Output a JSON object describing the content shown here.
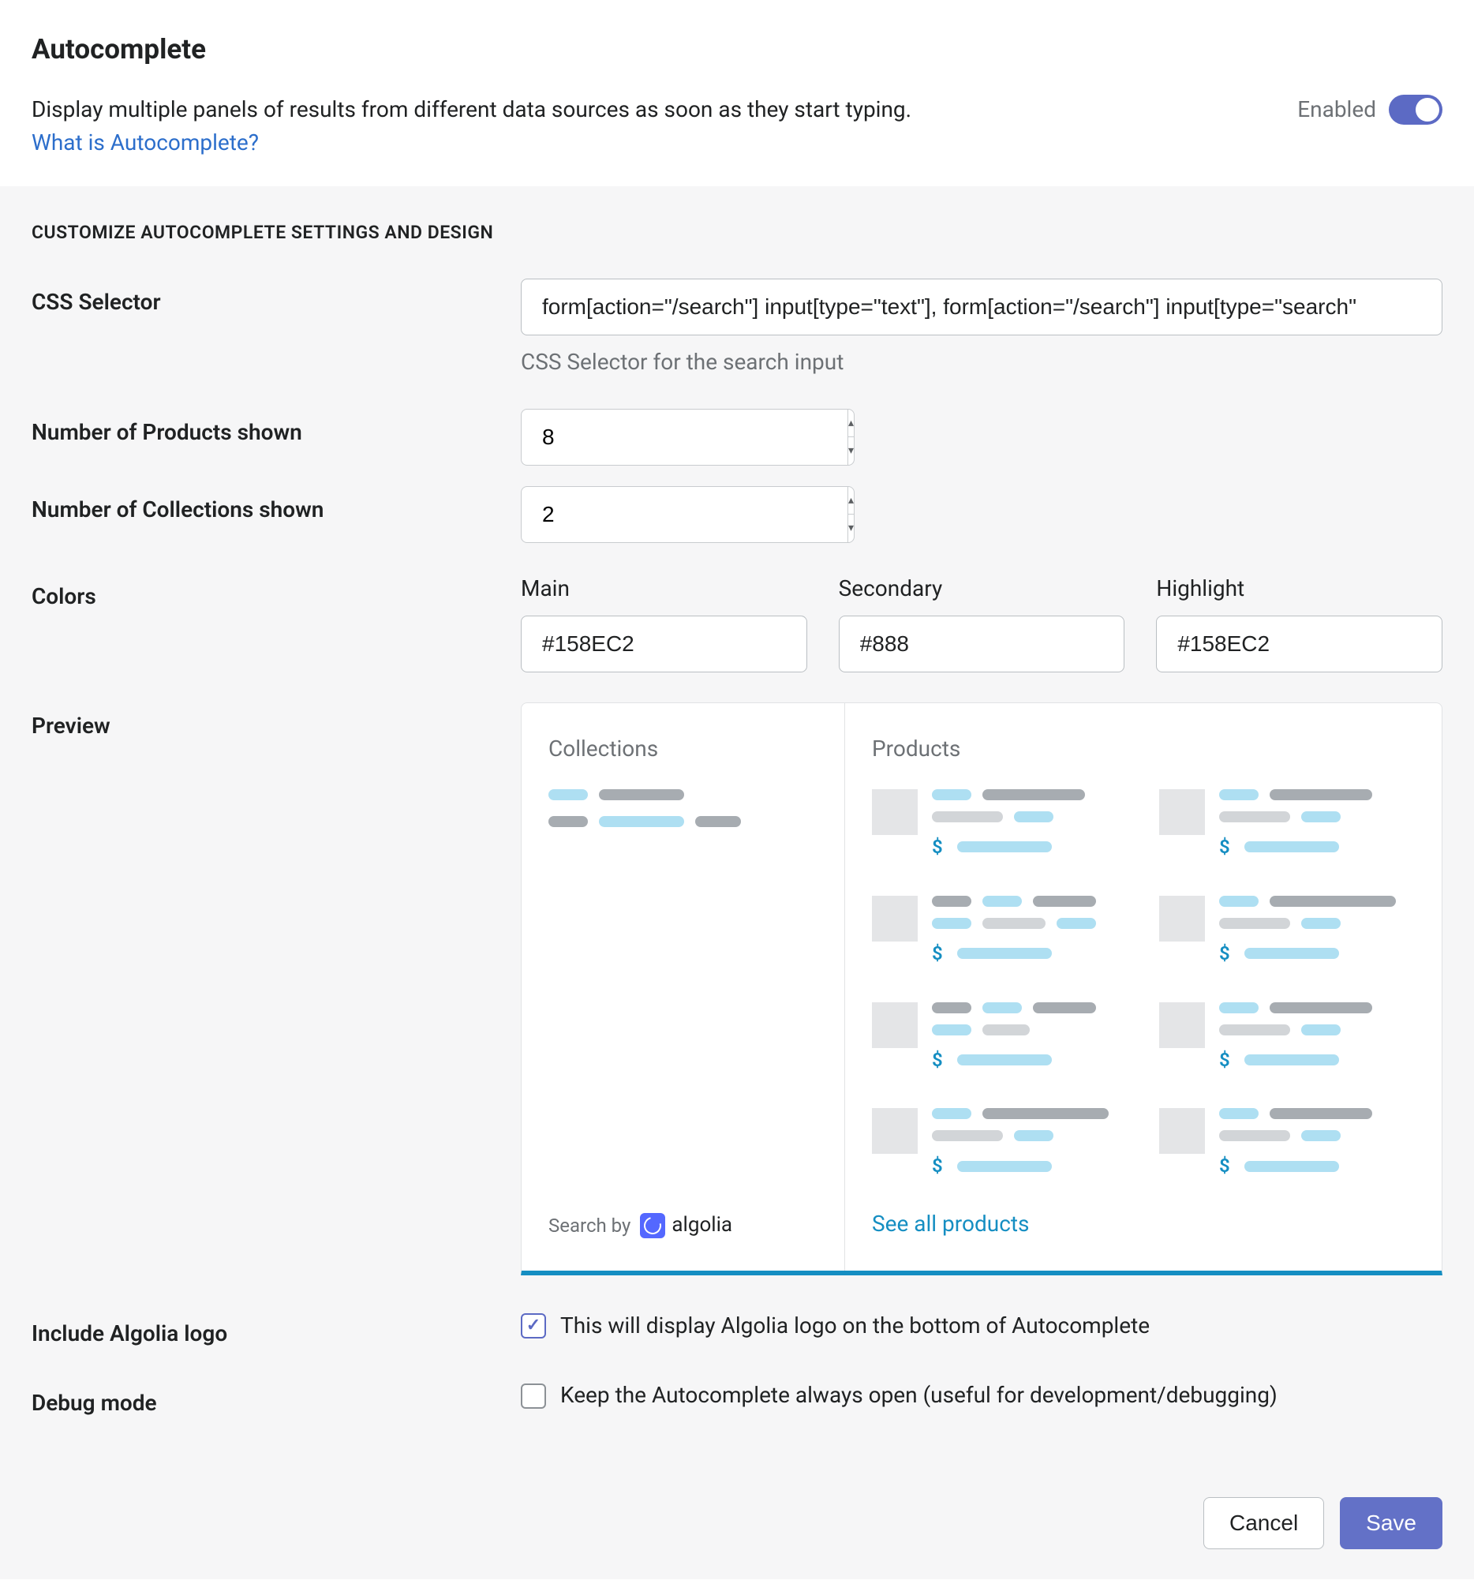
{
  "header": {
    "title": "Autocomplete",
    "description": "Display multiple panels of results from different data sources as soon as they start typing.",
    "link_text": "What is Autocomplete?",
    "enabled_label": "Enabled"
  },
  "section_title": "CUSTOMIZE AUTOCOMPLETE SETTINGS AND DESIGN",
  "fields": {
    "css_selector": {
      "label": "CSS Selector",
      "value": "form[action=\"/search\"] input[type=\"text\"], form[action=\"/search\"] input[type=\"search\"",
      "help": "CSS Selector for the search input"
    },
    "products_shown": {
      "label": "Number of Products shown",
      "value": "8"
    },
    "collections_shown": {
      "label": "Number of Collections shown",
      "value": "2"
    },
    "colors": {
      "label": "Colors",
      "main_label": "Main",
      "main_value": "#158EC2",
      "secondary_label": "Secondary",
      "secondary_value": "#888",
      "highlight_label": "Highlight",
      "highlight_value": "#158EC2"
    },
    "preview": {
      "label": "Preview",
      "collections_heading": "Collections",
      "products_heading": "Products",
      "search_by": "Search by",
      "algolia_text": "algolia",
      "see_all": "See all products",
      "dollar": "$"
    },
    "include_logo": {
      "label": "Include Algolia logo",
      "text": "This will display Algolia logo on the bottom of Autocomplete",
      "checked": true
    },
    "debug_mode": {
      "label": "Debug mode",
      "text": "Keep the Autocomplete always open (useful for development/debugging)",
      "checked": false
    }
  },
  "footer": {
    "cancel": "Cancel",
    "save": "Save"
  }
}
